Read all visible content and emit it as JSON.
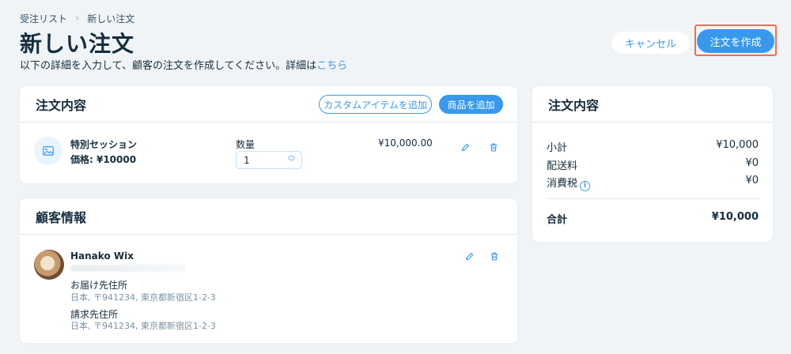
{
  "breadcrumb": {
    "parent": "受注リスト",
    "current": "新しい注文"
  },
  "header": {
    "title": "新しい注文",
    "subtitle": "以下の詳細を入力して、顧客の注文を作成してください。詳細は",
    "subtitle_link": "こちら",
    "cancel_label": "キャンセル",
    "create_label": "注文を作成"
  },
  "order": {
    "title": "注文内容",
    "add_custom_label": "カスタムアイテムを追加",
    "add_product_label": "商品を追加",
    "item": {
      "name": "特別セッション",
      "price": "価格: ¥10000",
      "qty_label": "数量",
      "qty_value": "1",
      "line_total": "¥10,000.00"
    }
  },
  "customer": {
    "title": "顧客情報",
    "name": "Hanako Wix",
    "shipping_title": "お届け先住所",
    "shipping_address": "日本, 〒941234, 東京都新宿区1-2-3",
    "billing_title": "請求先住所",
    "billing_address": "日本, 〒941234, 東京都新宿区1-2-3"
  },
  "summary": {
    "title": "注文内容",
    "subtotal_label": "小計",
    "subtotal_value": "¥10,000",
    "shipping_label": "配送料",
    "shipping_value": "¥0",
    "tax_label": "消費税",
    "tax_value": "¥0",
    "total_label": "合計",
    "total_value": "¥10,000"
  },
  "icons": {
    "image": "image-icon",
    "edit": "pencil-icon",
    "delete": "trash-icon",
    "info": "info-icon",
    "chevron": "chevron-right-icon"
  },
  "colors": {
    "accent": "#3899ec",
    "highlight": "#f26c4f",
    "background": "#f0f4f7"
  }
}
